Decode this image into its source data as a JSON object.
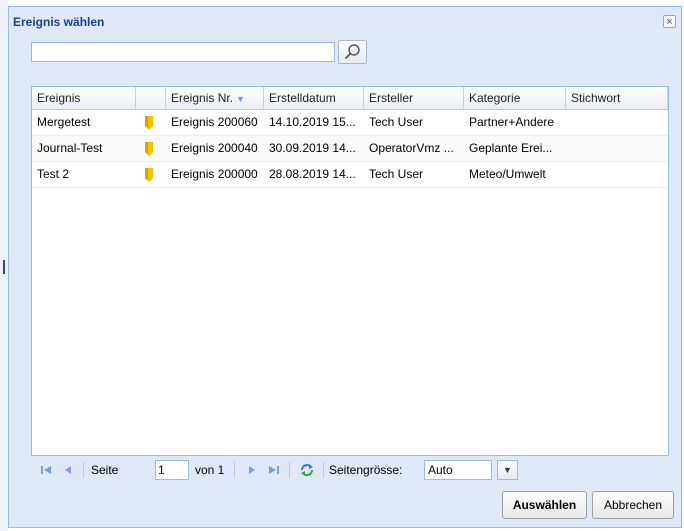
{
  "dialog": {
    "title": "Ereignis wählen",
    "close_symbol": "×"
  },
  "search": {
    "value": "",
    "placeholder": "",
    "button_icon": "search-icon"
  },
  "grid": {
    "columns": [
      "Ereignis",
      "",
      "Ereignis Nr.",
      "Erstelldatum",
      "Ersteller",
      "Kategorie",
      "Stichwort"
    ],
    "sort_indicator": "▼",
    "rows": [
      {
        "ereignis": "Mergetest",
        "flag_icon": "yellow-flag-icon",
        "nr": "Ereignis 200060",
        "datum": "14.10.2019 15...",
        "ersteller": "Tech User",
        "kategorie": "Partner+Andere",
        "stichwort": ""
      },
      {
        "ereignis": "Journal-Test",
        "flag_icon": "yellow-flag-icon",
        "nr": "Ereignis 200040",
        "datum": "30.09.2019 14...",
        "ersteller": "OperatorVmz ...",
        "kategorie": "Geplante Erei...",
        "stichwort": ""
      },
      {
        "ereignis": "Test 2",
        "flag_icon": "yellow-flag-icon",
        "nr": "Ereignis 200000",
        "datum": "28.08.2019 14...",
        "ersteller": "Tech User",
        "kategorie": "Meteo/Umwelt",
        "stichwort": ""
      }
    ]
  },
  "pager": {
    "page_label": "Seite",
    "page_value": "1",
    "of_label": "von 1",
    "size_label": "Seitengrösse:",
    "size_value": "Auto",
    "icons": [
      "first-page-icon",
      "prev-page-icon",
      "next-page-icon",
      "last-page-icon",
      "refresh-icon",
      "dropdown-arrow-icon"
    ]
  },
  "buttons": {
    "select": "Auswählen",
    "cancel": "Abbrechen"
  },
  "colors": {
    "accent": "#15428b",
    "frame": "#99bbe8",
    "flag": "#f2c200"
  }
}
